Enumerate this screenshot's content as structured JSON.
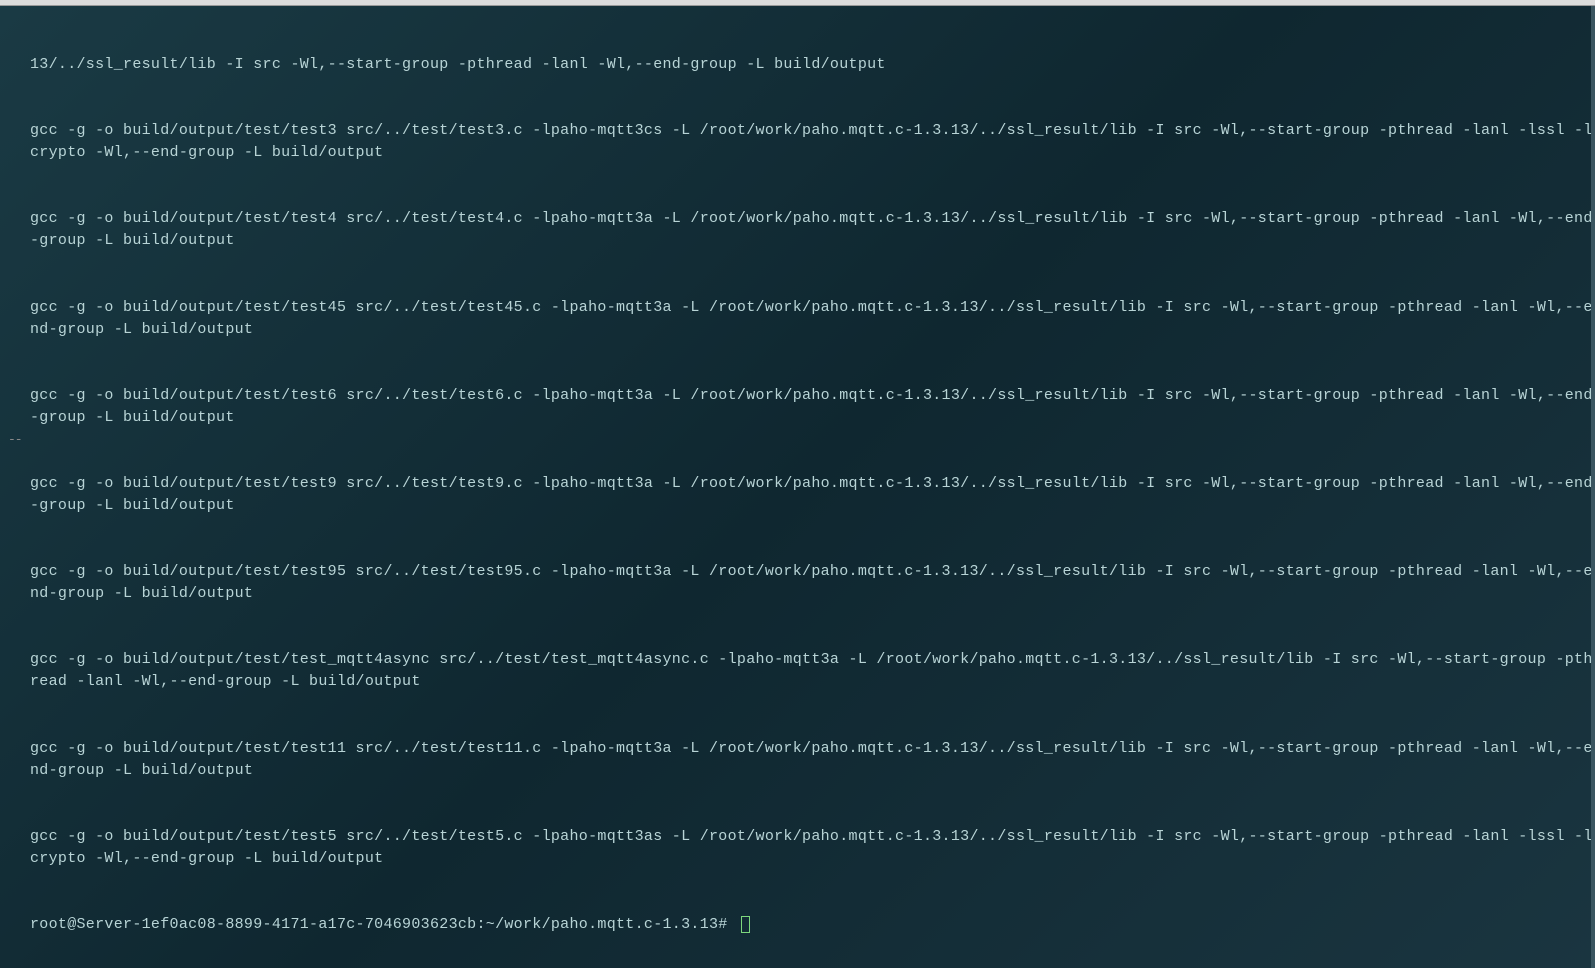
{
  "terminal": {
    "lines": [
      "13/../ssl_result/lib -I src -Wl,--start-group -pthread -lanl -Wl,--end-group -L build/output",
      "gcc -g -o build/output/test/test3 src/../test/test3.c -lpaho-mqtt3cs -L /root/work/paho.mqtt.c-1.3.13/../ssl_result/lib -I src -Wl,--start-group -pthread -lanl -lssl -lcrypto -Wl,--end-group -L build/output",
      "gcc -g -o build/output/test/test4 src/../test/test4.c -lpaho-mqtt3a -L /root/work/paho.mqtt.c-1.3.13/../ssl_result/lib -I src -Wl,--start-group -pthread -lanl -Wl,--end-group -L build/output",
      "gcc -g -o build/output/test/test45 src/../test/test45.c -lpaho-mqtt3a -L /root/work/paho.mqtt.c-1.3.13/../ssl_result/lib -I src -Wl,--start-group -pthread -lanl -Wl,--end-group -L build/output",
      "gcc -g -o build/output/test/test6 src/../test/test6.c -lpaho-mqtt3a -L /root/work/paho.mqtt.c-1.3.13/../ssl_result/lib -I src -Wl,--start-group -pthread -lanl -Wl,--end-group -L build/output",
      "gcc -g -o build/output/test/test9 src/../test/test9.c -lpaho-mqtt3a -L /root/work/paho.mqtt.c-1.3.13/../ssl_result/lib -I src -Wl,--start-group -pthread -lanl -Wl,--end-group -L build/output",
      "gcc -g -o build/output/test/test95 src/../test/test95.c -lpaho-mqtt3a -L /root/work/paho.mqtt.c-1.3.13/../ssl_result/lib -I src -Wl,--start-group -pthread -lanl -Wl,--end-group -L build/output",
      "gcc -g -o build/output/test/test_mqtt4async src/../test/test_mqtt4async.c -lpaho-mqtt3a -L /root/work/paho.mqtt.c-1.3.13/../ssl_result/lib -I src -Wl,--start-group -pthread -lanl -Wl,--end-group -L build/output",
      "gcc -g -o build/output/test/test11 src/../test/test11.c -lpaho-mqtt3a -L /root/work/paho.mqtt.c-1.3.13/../ssl_result/lib -I src -Wl,--start-group -pthread -lanl -Wl,--end-group -L build/output",
      "gcc -g -o build/output/test/test5 src/../test/test5.c -lpaho-mqtt3as -L /root/work/paho.mqtt.c-1.3.13/../ssl_result/lib -I src -Wl,--start-group -pthread -lanl -lssl -lcrypto -Wl,--end-group -L build/output"
    ],
    "prompt": "root@Server-1ef0ac08-8899-4171-a17c-7046903623cb:~/work/paho.mqtt.c-1.3.13# ",
    "left_marker": "--"
  }
}
